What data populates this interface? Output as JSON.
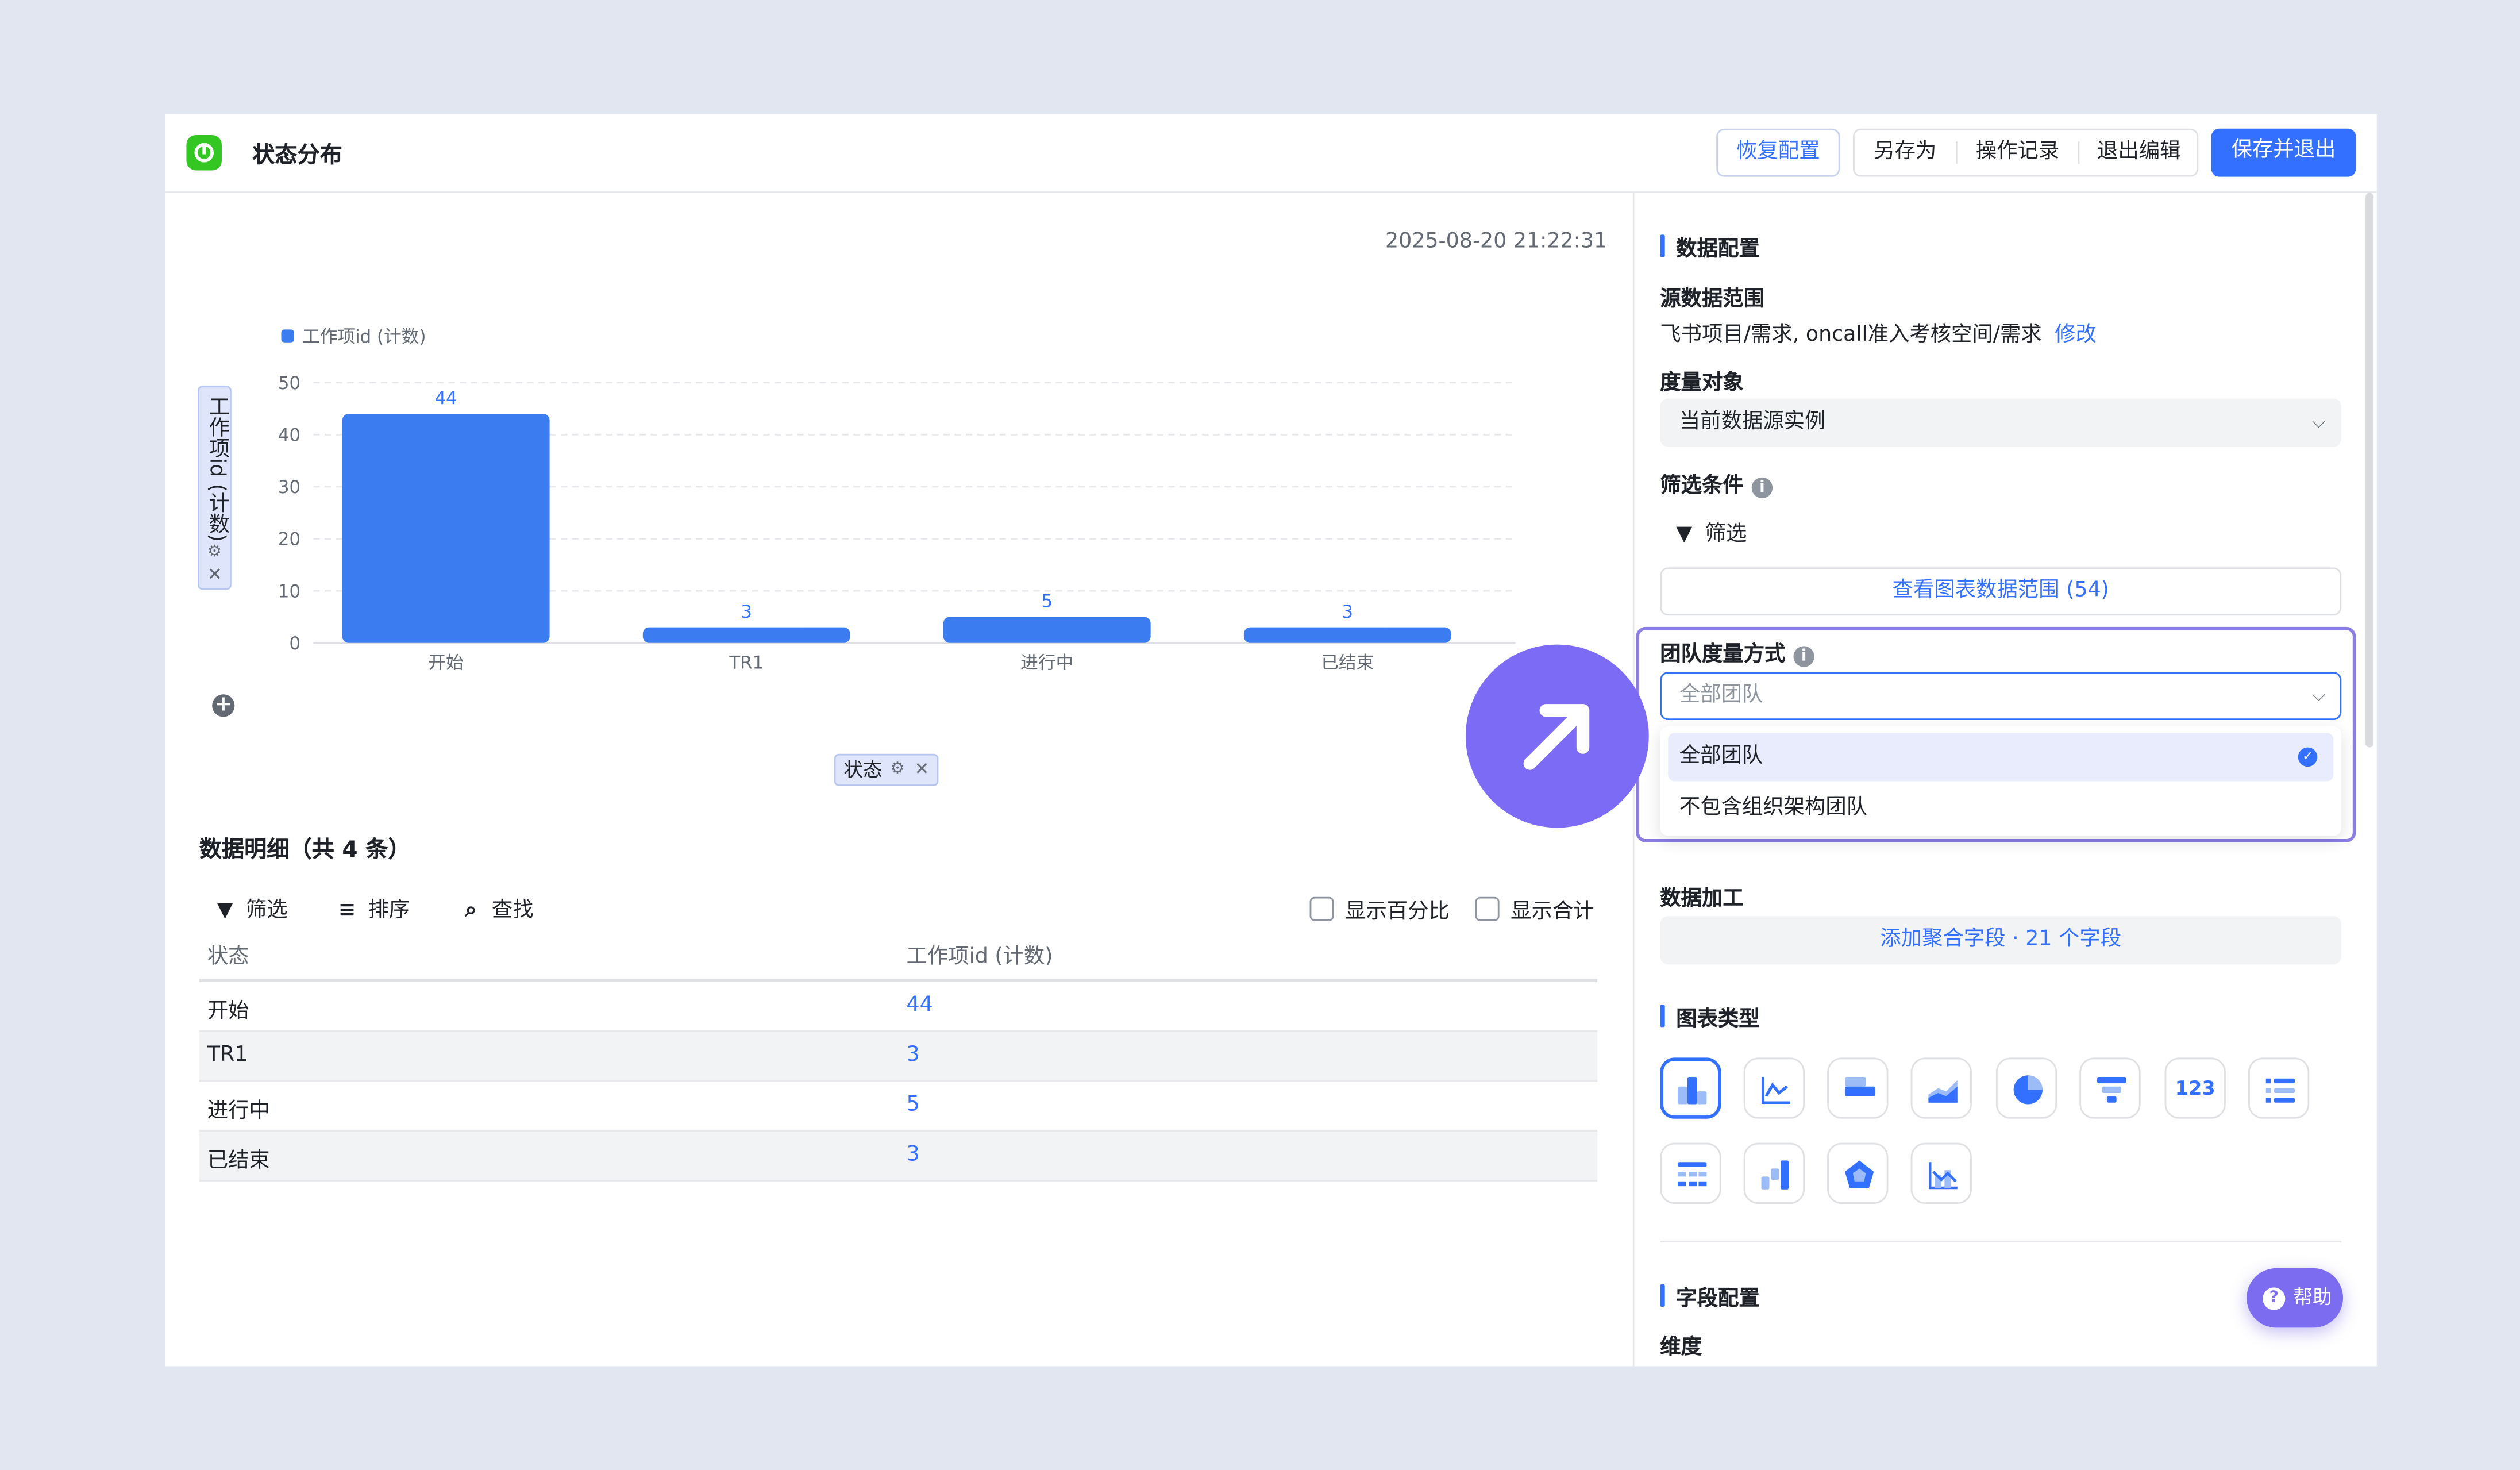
{
  "header": {
    "title": "状态分布",
    "restore_label": "恢复配置",
    "save_as_label": "另存为",
    "history_label": "操作记录",
    "exit_edit_label": "退出编辑",
    "save_exit_label": "保存并退出"
  },
  "chart": {
    "timestamp": "2025-08-20 21:22:31",
    "y_axis_pill": "工作项id (计数)",
    "x_axis_pill": "状态",
    "legend_entry": "工作项id (计数)"
  },
  "chart_data": {
    "type": "bar",
    "categories": [
      "开始",
      "TR1",
      "进行中",
      "已结束"
    ],
    "series": [
      {
        "name": "工作项id (计数)",
        "values": [
          44,
          3,
          5,
          3
        ]
      }
    ],
    "ylabel": "工作项id (计数)",
    "xlabel": "状态",
    "ylim": [
      0,
      50
    ],
    "yticks": [
      0,
      10,
      20,
      30,
      40,
      50
    ],
    "grid": true,
    "legend_position": "top-left",
    "bar_color": "#3b7cf0"
  },
  "details": {
    "title": "数据明细（共 4 条）",
    "filter_label": "筛选",
    "sort_label": "排序",
    "find_label": "查找",
    "show_percent_label": "显示百分比",
    "show_total_label": "显示合计",
    "columns": [
      "状态",
      "工作项id (计数)"
    ],
    "rows": [
      {
        "status": "开始",
        "count": "44"
      },
      {
        "status": "TR1",
        "count": "3"
      },
      {
        "status": "进行中",
        "count": "5"
      },
      {
        "status": "已结束",
        "count": "3"
      }
    ]
  },
  "config": {
    "data_config_title": "数据配置",
    "source_label": "源数据范围",
    "source_value": "飞书项目/需求, oncall准入考核空间/需求",
    "modify_link": "修改",
    "measure_label": "度量对象",
    "measure_value": "当前数据源实例",
    "filter_cond_label": "筛选条件",
    "filter_label": "筛选",
    "view_range_label": "查看图表数据范围 (54)",
    "team_label": "团队度量方式",
    "team_placeholder": "全部团队",
    "team_options": [
      "全部团队",
      "不包含组织架构团队"
    ],
    "team_selected": "全部团队",
    "processing_label": "数据加工",
    "agg_label": "添加聚合字段 · 21 个字段",
    "chart_type_title": "图表类型",
    "chart_types": [
      "column",
      "line",
      "bar",
      "area",
      "pie",
      "funnel",
      "number",
      "list",
      "table",
      "waterfall",
      "radar",
      "combo"
    ],
    "number_type_label": "123",
    "field_config_title": "字段配置",
    "dimension_label": "维度",
    "help_label": "帮助"
  },
  "colors": {
    "accent": "#3370ff",
    "highlight": "#7c6cf5",
    "bar": "#3b7cf0",
    "success": "#34c724"
  }
}
